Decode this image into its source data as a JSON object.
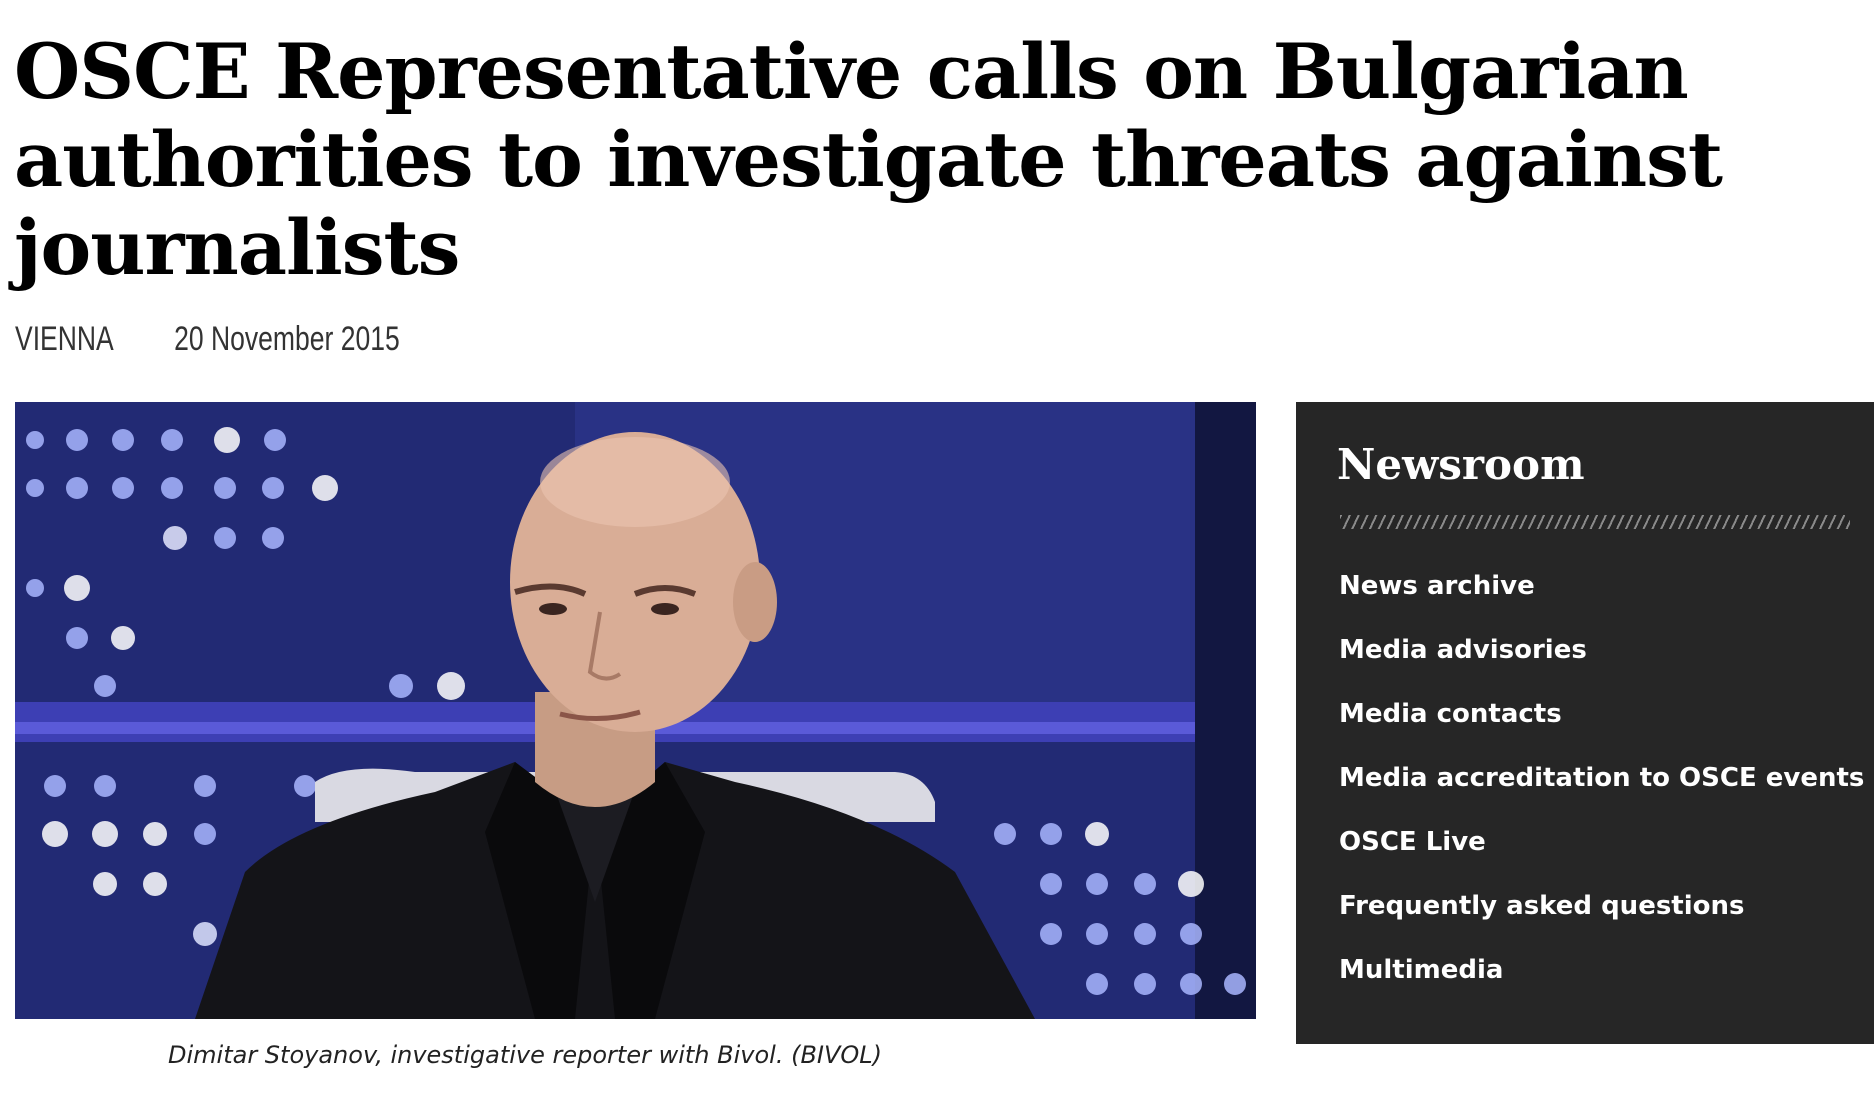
{
  "article": {
    "headline": "OSCE Representative calls on Bulgarian authorities to investigate threats against journalists",
    "location": "VIENNA",
    "date": "20 November 2015"
  },
  "photo": {
    "caption": "Dimitar Stoyanov, investigative reporter with Bivol. (BIVOL)"
  },
  "newsroom": {
    "title": "Newsroom",
    "items": [
      {
        "label": "News archive"
      },
      {
        "label": "Media advisories"
      },
      {
        "label": "Media contacts"
      },
      {
        "label": "Media accreditation to OSCE events"
      },
      {
        "label": "OSCE Live"
      },
      {
        "label": "Frequently asked questions"
      },
      {
        "label": "Multimedia"
      }
    ]
  },
  "colors": {
    "sidebar_bg": "#262626",
    "studio_blue": "#262f7e",
    "text": "#000000"
  }
}
